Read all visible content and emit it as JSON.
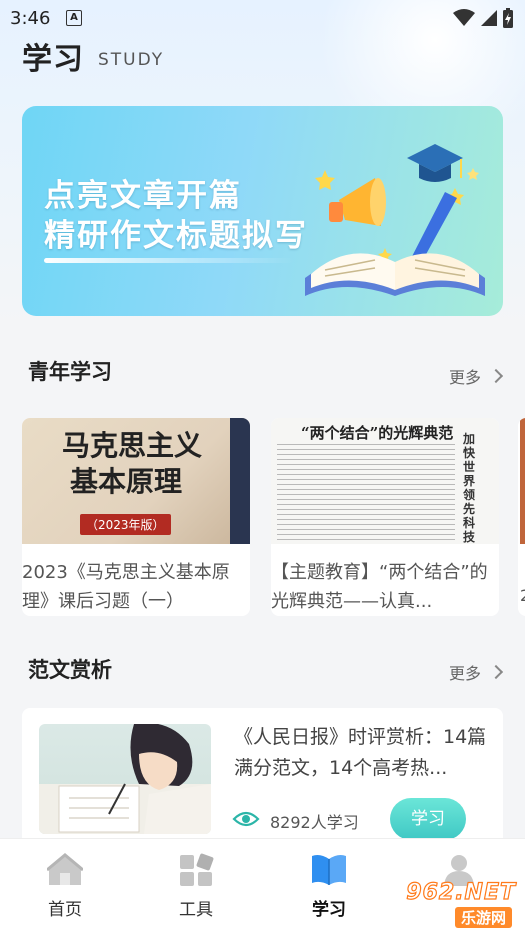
{
  "status": {
    "time": "3:46",
    "notif_icon": "a-badge-icon"
  },
  "header": {
    "title": "学习",
    "subtitle": "STUDY"
  },
  "banner": {
    "line1": "点亮文章开篇",
    "line2": "精研作文标题拟写"
  },
  "youth": {
    "heading": "青年学习",
    "more": "更多",
    "cards": [
      {
        "cover_line1": "马克思主义",
        "cover_line2": "基本原理",
        "cover_year": "（2023年版）",
        "text": "2023《马克思主义基本原理》课后习题（一）"
      },
      {
        "cover_headline": "“两个结合”的光辉典范",
        "cover_side": "加快世界领先科技园区建设",
        "text": "【主题教育】“两个结合”的光辉典范——认真..."
      }
    ],
    "peek_text": "2"
  },
  "essays": {
    "heading": "范文赏析",
    "more": "更多",
    "article": {
      "title": "《人民日报》时评赏析：14篇满分范文，14个高考热...",
      "count": "8292人学习",
      "button": "学习"
    }
  },
  "nav": {
    "items": [
      {
        "label": "首页",
        "icon": "home-icon"
      },
      {
        "label": "工具",
        "icon": "tools-icon"
      },
      {
        "label": "学习",
        "icon": "book-icon"
      },
      {
        "label": "我的",
        "icon": "user-icon"
      }
    ]
  },
  "watermark": {
    "main": "962.NET",
    "sub": "乐游网"
  },
  "colors": {
    "accent": "#3fc8c4",
    "nav_active": "#2f8ff0",
    "banner_start": "#6fd6f5",
    "banner_end": "#a6ecd9"
  }
}
